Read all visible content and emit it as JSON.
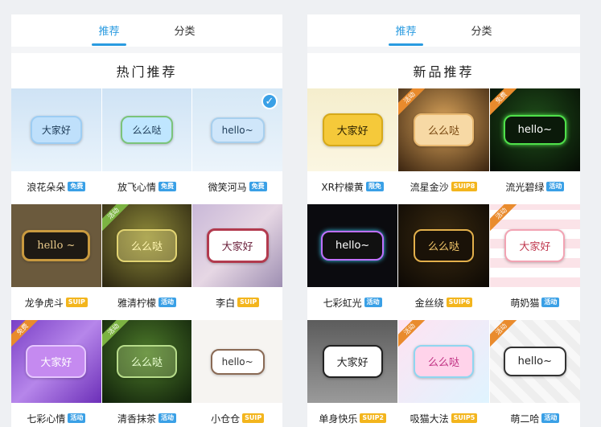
{
  "tabs": {
    "recommend": "推荐",
    "category": "分类"
  },
  "left": {
    "title": "热门推荐",
    "items": [
      {
        "name": "浪花朵朵",
        "badge": "免费",
        "badge_type": "free",
        "text": "大家好"
      },
      {
        "name": "放飞心情",
        "badge": "免费",
        "badge_type": "free",
        "text": "么么哒"
      },
      {
        "name": "微笑河马",
        "badge": "免费",
        "badge_type": "free",
        "text": "hello~"
      },
      {
        "name": "龙争虎斗",
        "badge": "SUIP",
        "badge_type": "vip",
        "text": "hello ~"
      },
      {
        "name": "雅清柠檬",
        "badge": "活动",
        "badge_type": "act",
        "text": "么么哒",
        "corner": "活动"
      },
      {
        "name": "李白",
        "badge": "SUIP",
        "badge_type": "vip",
        "text": "大家好"
      },
      {
        "name": "七彩心情",
        "badge": "活动",
        "badge_type": "act",
        "text": "大家好",
        "corner": "免费"
      },
      {
        "name": "清香抹茶",
        "badge": "活动",
        "badge_type": "act",
        "text": "么么哒",
        "corner": "活动"
      },
      {
        "name": "小仓仓",
        "badge": "SUIP",
        "badge_type": "vip",
        "text": "hello~"
      }
    ]
  },
  "right": {
    "title": "新品推荐",
    "items": [
      {
        "name": "XR柠檬黄",
        "badge": "限免",
        "badge_type": "free",
        "text": "大家好"
      },
      {
        "name": "流星金沙",
        "badge": "SUIP8",
        "badge_type": "vip",
        "text": "么么哒",
        "corner": "活动"
      },
      {
        "name": "流光碧绿",
        "badge": "活动",
        "badge_type": "act",
        "text": "hello~",
        "corner": "免费"
      },
      {
        "name": "七彩虹光",
        "badge": "活动",
        "badge_type": "act",
        "text": "hello~"
      },
      {
        "name": "金丝绕",
        "badge": "SUIP6",
        "badge_type": "vip",
        "text": "么么哒"
      },
      {
        "name": "萌奶猫",
        "badge": "活动",
        "badge_type": "act",
        "text": "大家好",
        "corner": "活动"
      },
      {
        "name": "单身快乐",
        "badge": "SUIP2",
        "badge_type": "vip",
        "text": "大家好"
      },
      {
        "name": "吸猫大法",
        "badge": "SUIP5",
        "badge_type": "vip",
        "text": "么么哒",
        "corner": "活动"
      },
      {
        "name": "萌二哈",
        "badge": "活动",
        "badge_type": "act",
        "text": "hello~",
        "corner": "活动"
      }
    ]
  },
  "colors": {
    "accent": "#2a9be0",
    "vip": "#f3b51d"
  }
}
